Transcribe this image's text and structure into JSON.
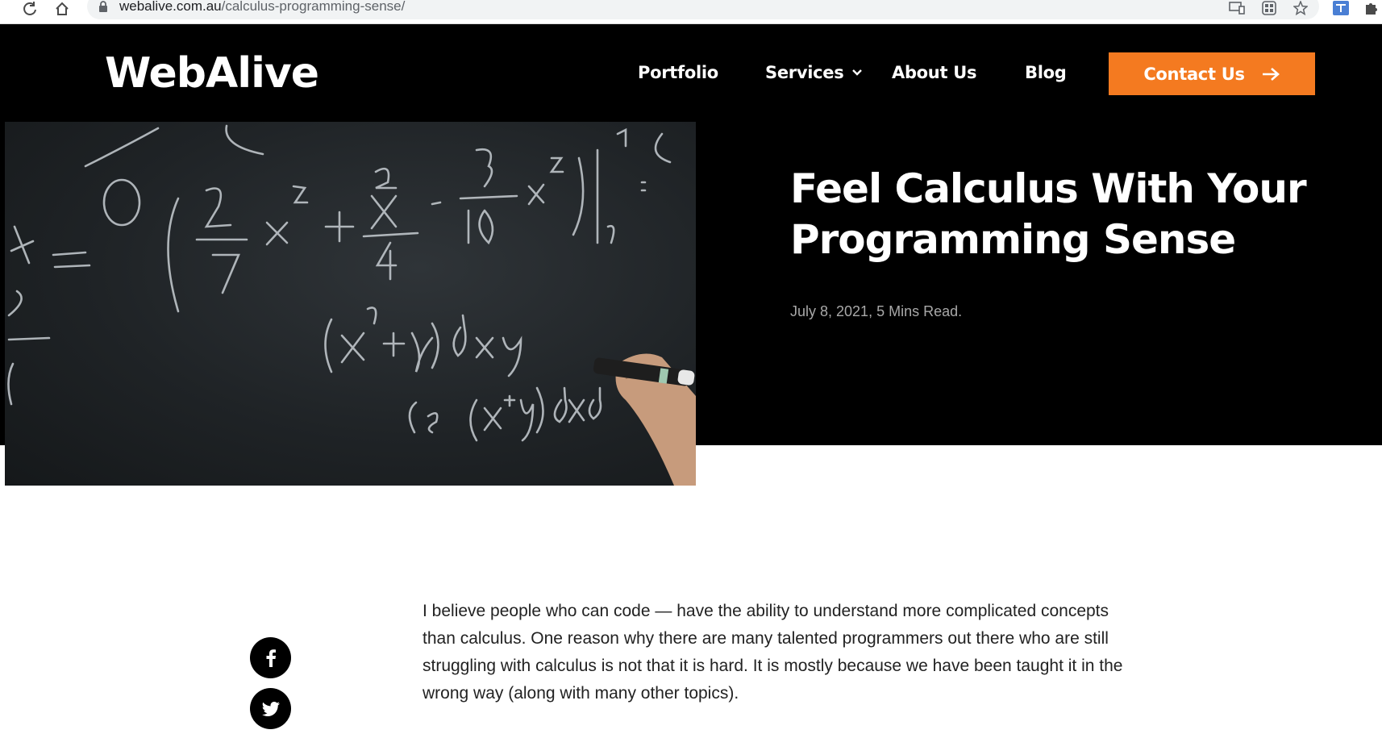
{
  "browser": {
    "url_domain": "webalive.com.au",
    "url_path": "/calculus-programming-sense/"
  },
  "header": {
    "logo": "WebAlive",
    "nav": [
      {
        "label": "Portfolio"
      },
      {
        "label": "Services"
      },
      {
        "label": "About Us"
      },
      {
        "label": "Blog"
      }
    ],
    "contact_label": "Contact Us"
  },
  "hero": {
    "title": "Feel Calculus With Your Programming Sense",
    "meta": "July 8, 2021, 5 Mins Read."
  },
  "article": {
    "intro": "I believe people who can code — have the ability to understand more complicated concepts than calculus. One reason why there are many talented programmers out there who are still struggling with calculus is not that it is hard. It is mostly because we have been taught it in the wrong way (along with many other topics)."
  },
  "colors": {
    "accent": "#f47a20",
    "header_bg": "#000000"
  },
  "icons": {
    "share": [
      "facebook-icon",
      "twitter-icon"
    ]
  }
}
